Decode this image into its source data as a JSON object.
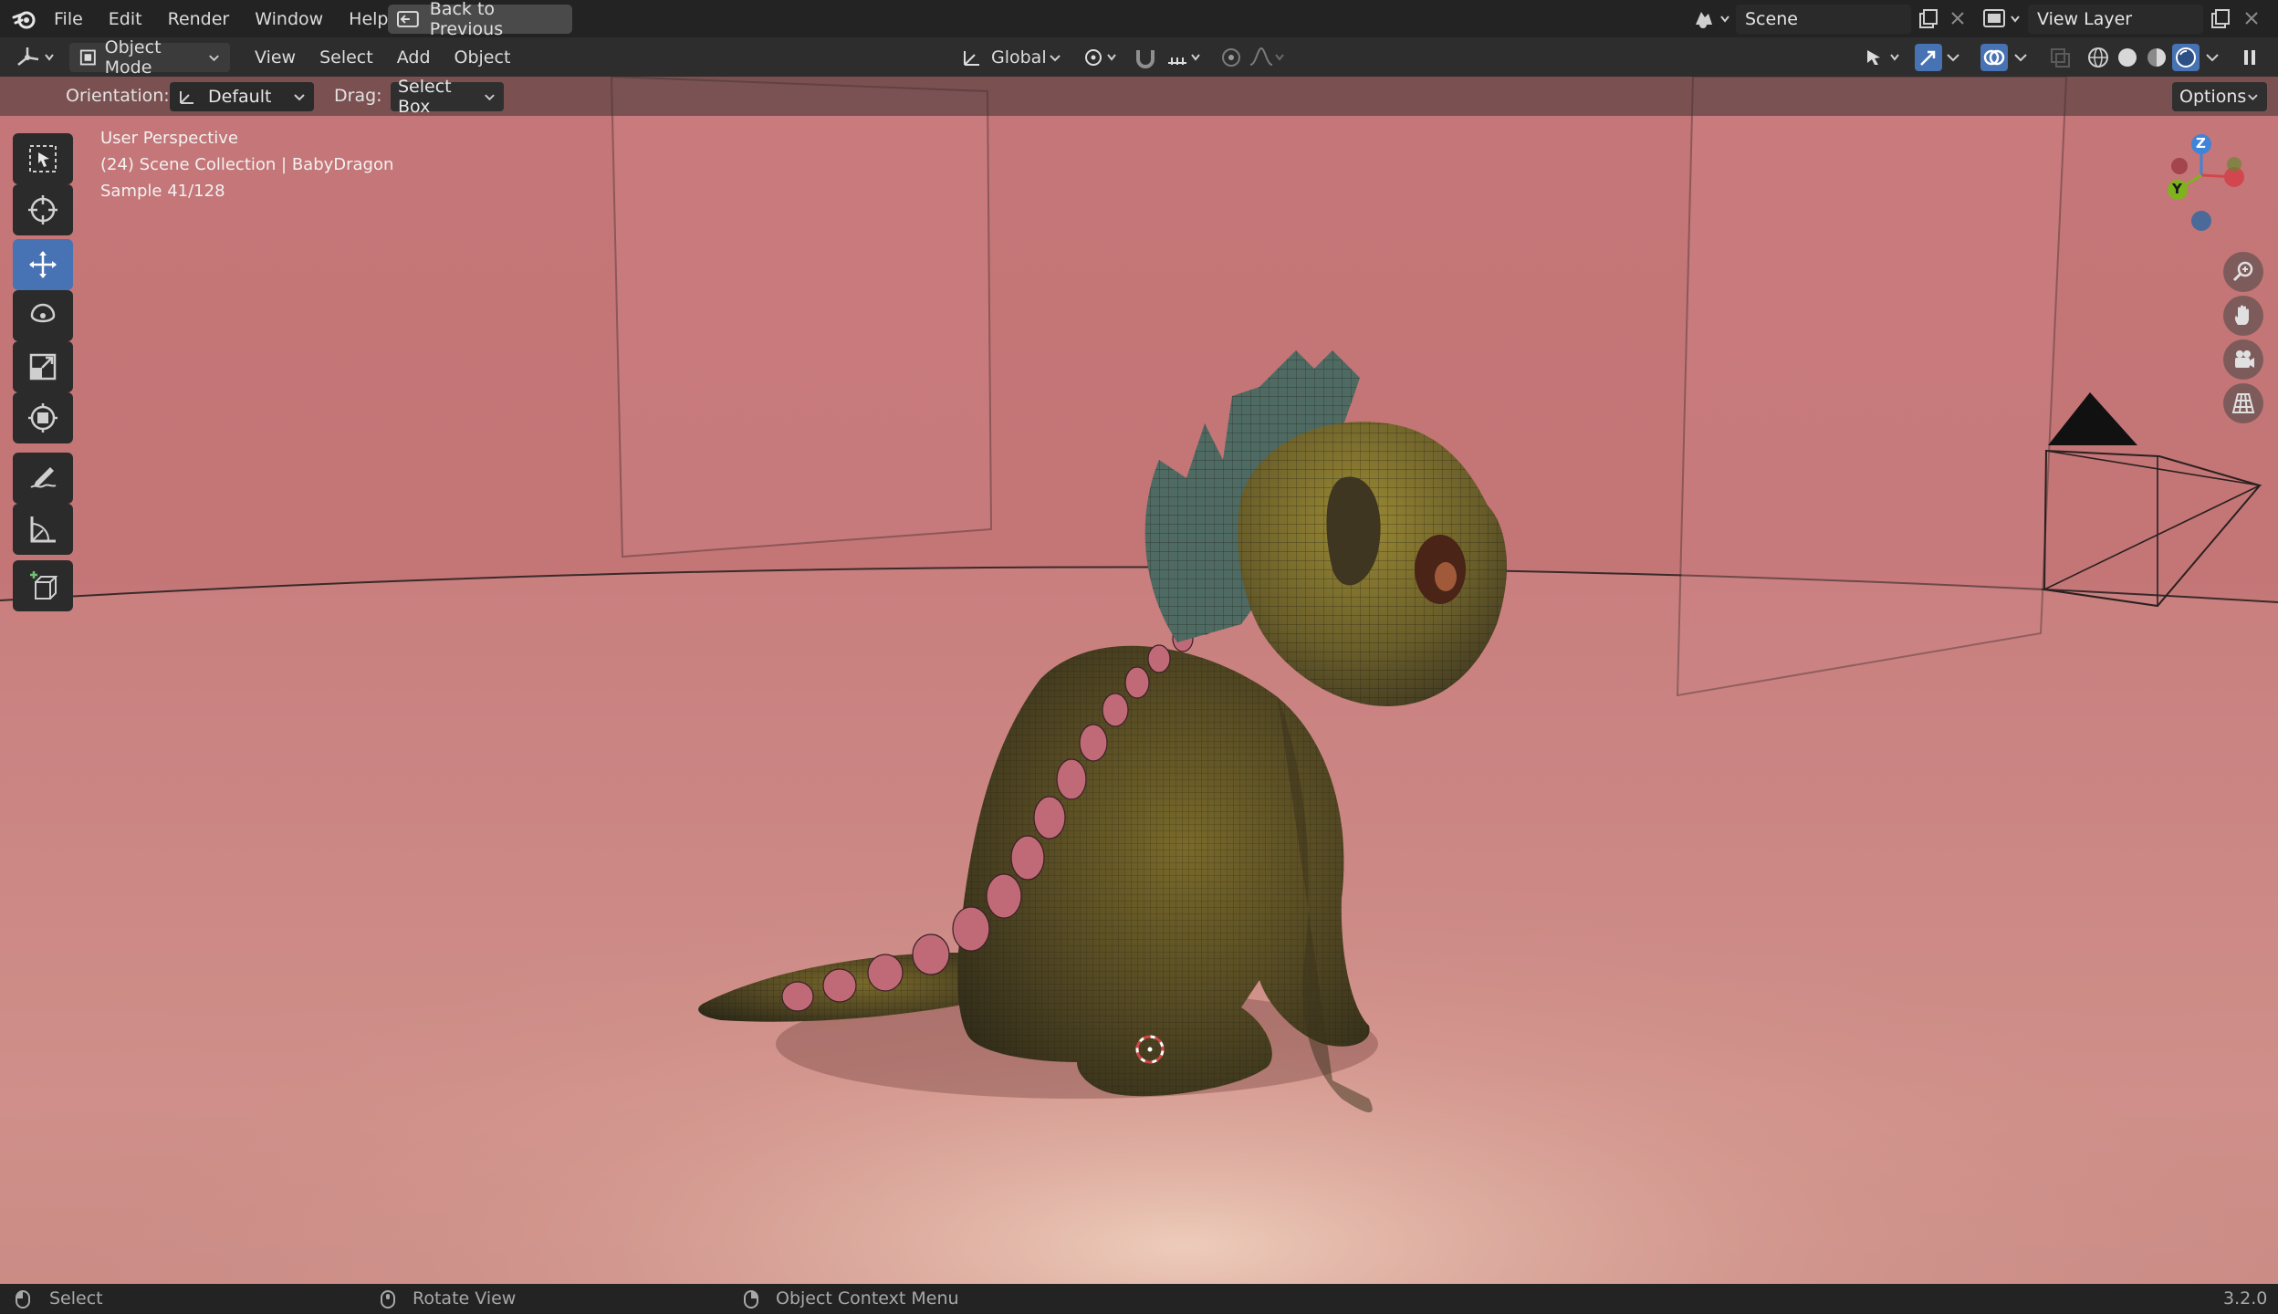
{
  "topbar": {
    "menus": [
      "File",
      "Edit",
      "Render",
      "Window",
      "Help"
    ],
    "back_button": "Back to Previous",
    "scene_label": "Scene",
    "view_layer_label": "View Layer"
  },
  "header": {
    "mode": "Object Mode",
    "menus": [
      "View",
      "Select",
      "Add",
      "Object"
    ],
    "transform_orientation": "Global"
  },
  "tool_settings": {
    "orientation_label": "Orientation:",
    "orientation_value": "Default",
    "drag_label": "Drag:",
    "drag_value": "Select Box",
    "options_label": "Options"
  },
  "viewport": {
    "info_line1": "User Perspective",
    "info_line2": "(24) Scene Collection | BabyDragon",
    "info_line3": "Sample 41/128",
    "gizmo_z": "Z",
    "gizmo_y": "Y"
  },
  "statusbar": {
    "select": "Select",
    "rotate": "Rotate View",
    "context": "Object Context Menu",
    "version": "3.2.0"
  },
  "colors": {
    "accent": "#4772b3",
    "background": "#c57678",
    "axis_x": "#d2474f",
    "axis_y": "#7fb31d",
    "axis_z": "#3f84d8"
  }
}
